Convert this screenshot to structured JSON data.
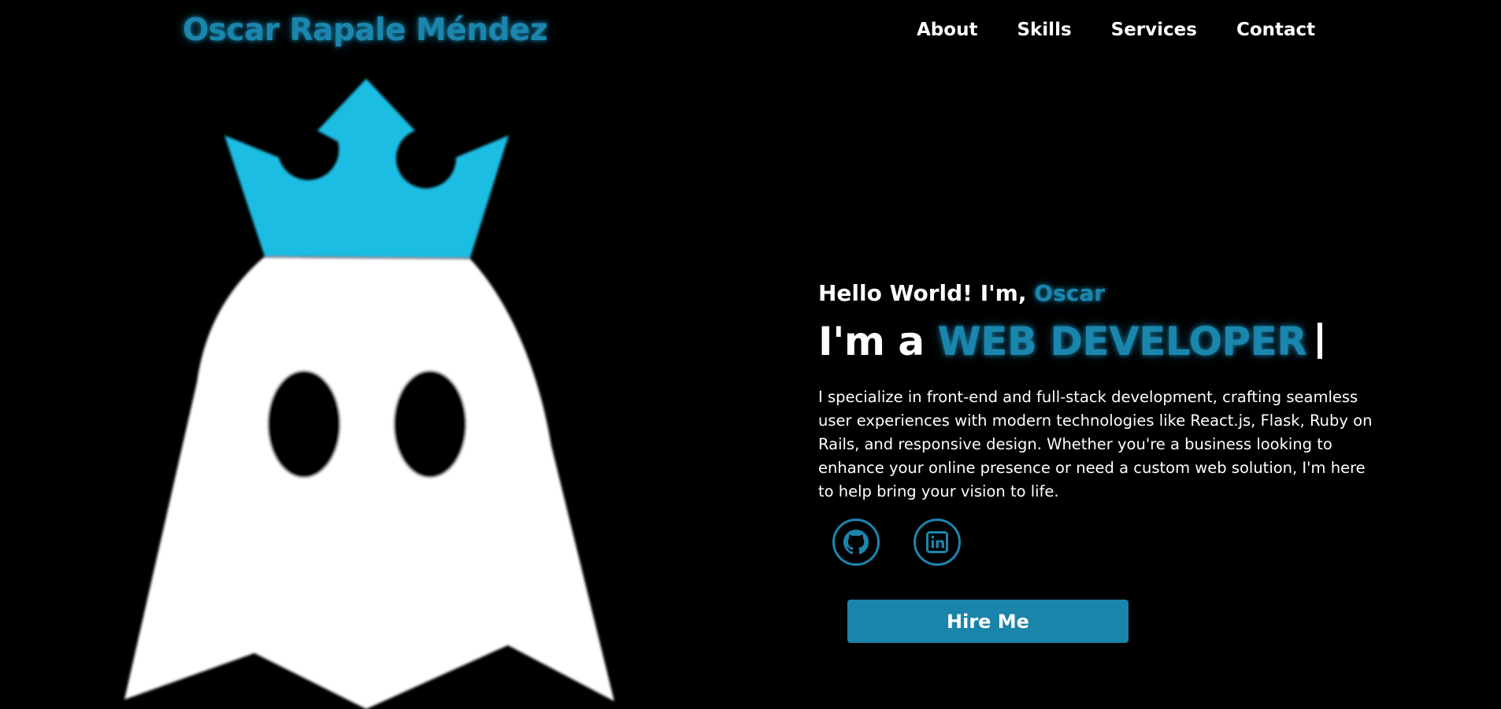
{
  "header": {
    "brand": "Oscar Rapale Méndez",
    "nav": [
      "About",
      "Skills",
      "Services",
      "Contact"
    ]
  },
  "hero": {
    "greeting": "Hello World! I'm,",
    "name": "Oscar",
    "role_prefix": "I'm a",
    "role": "WEB DEVELOPER",
    "description": "I specialize in front-end and full-stack development, crafting seamless user experiences with modern technologies like React.js, Flask, Ruby on Rails, and responsive design. Whether you're a business looking to enhance your online presence or need a custom web solution, I'm here to help bring your vision to life.",
    "hire_label": "Hire Me"
  },
  "social": {
    "github_icon": "github-icon",
    "linkedin_icon": "linkedin-icon"
  },
  "logo": {
    "icon": "crowned-ghost-icon"
  },
  "colors": {
    "background": "#000000",
    "accent": "#1b86ad",
    "crown": "#1cbde3",
    "ghost": "#ffffff",
    "text": "#ffffff"
  }
}
